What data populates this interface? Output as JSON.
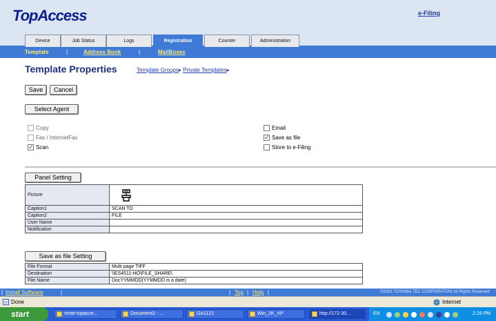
{
  "header": {
    "logo": "TopAccess",
    "efiling_link": "e-Filing"
  },
  "tabs": [
    {
      "label": "Device"
    },
    {
      "label": "Job Status"
    },
    {
      "label": "Logs"
    },
    {
      "label": "Registration"
    },
    {
      "label": "Counter"
    },
    {
      "label": "Administration"
    }
  ],
  "subnav": {
    "template": "Template",
    "address_book": "Address Book",
    "mailboxes": "MailBoxes",
    "sep": "|"
  },
  "page": {
    "title": "Template Properties",
    "crumb_groups": "Template Groups",
    "crumb_private": "Private Templates",
    "crumb_arrow": "▸"
  },
  "buttons": {
    "save": "Save",
    "cancel": "Cancel",
    "select_agent": "Select Agent",
    "panel_setting": "Panel Setting",
    "save_as_file_setting": "Save as file Setting"
  },
  "agents": {
    "copy": {
      "label": "Copy",
      "checked": false
    },
    "fax": {
      "label": "Fax / InternetFax",
      "checked": false
    },
    "scan": {
      "label": "Scan",
      "checked": true
    },
    "email": {
      "label": "Email",
      "checked": false
    },
    "save_as_file": {
      "label": "Save as file",
      "checked": true
    },
    "store_efiling": {
      "label": "Store to e-Filing",
      "checked": false
    }
  },
  "panel_table": {
    "picture_label": "Picture",
    "rows": [
      {
        "key": "Caption1",
        "value": "SCAN TO"
      },
      {
        "key": "Caption2",
        "value": "FILE"
      },
      {
        "key": "User Name",
        "value": ""
      },
      {
        "key": "Notification",
        "value": ""
      }
    ]
  },
  "file_table": {
    "rows": [
      {
        "key": "File Format",
        "value": "Multi page TIFF"
      },
      {
        "key": "Destination",
        "value": "\\\\ES4511-HO\\FILE_SHARE\\"
      },
      {
        "key": "File Name",
        "value": "DocYYMMDD(YYMMDD is a date)"
      }
    ]
  },
  "footer": {
    "install": "Install Software",
    "top": "Top",
    "help": "Help",
    "sep": "|",
    "copyright": "©2003 TOSHIBA TEC CORPORATION All Rights Reserved"
  },
  "ie_status": {
    "done": "Done",
    "zone": "Internet"
  },
  "taskbar": {
    "start": "start",
    "tasks": [
      {
        "label": "rente-topacce..."
      },
      {
        "label": "Document3 - ..."
      },
      {
        "label": "GA1121"
      },
      {
        "label": "Win_2K_XP"
      },
      {
        "label": "http://172-30..."
      }
    ],
    "lang": "EN",
    "clock": "2:29 PM"
  },
  "colors": {
    "accent": "#3f7ad6",
    "link": "#1f3aa8",
    "title": "#1b2f7c",
    "sublink": "#ffe97a"
  },
  "icons": [
    "scan-to-file-icon",
    "checkbox-icon",
    "ie-globe-icon",
    "folder-icon"
  ]
}
